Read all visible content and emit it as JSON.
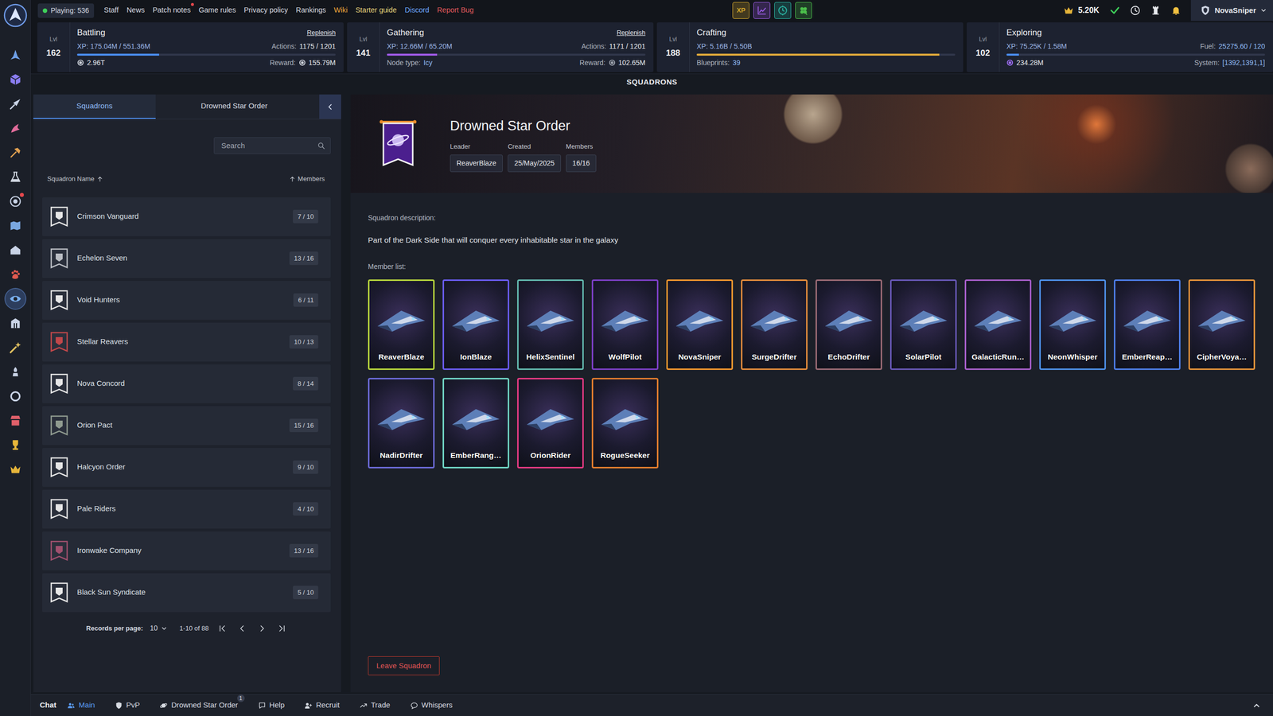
{
  "sidebar": {
    "items": [
      {
        "selected": false,
        "alert": false
      },
      {
        "selected": false,
        "alert": false
      },
      {
        "selected": false,
        "alert": false
      },
      {
        "selected": false,
        "alert": false
      },
      {
        "selected": false,
        "alert": false
      },
      {
        "selected": false,
        "alert": false
      },
      {
        "selected": false,
        "alert": true
      },
      {
        "selected": false,
        "alert": false
      },
      {
        "selected": false,
        "alert": false
      },
      {
        "selected": false,
        "alert": false
      },
      {
        "selected": true,
        "alert": false
      },
      {
        "selected": false,
        "alert": false
      },
      {
        "selected": false,
        "alert": false
      },
      {
        "selected": false,
        "alert": false
      },
      {
        "selected": false,
        "alert": false
      },
      {
        "selected": false,
        "alert": false
      },
      {
        "selected": false,
        "alert": false
      },
      {
        "selected": false,
        "alert": false
      }
    ]
  },
  "topbar": {
    "playing": "Playing: 536",
    "links": [
      {
        "label": "Staff",
        "color": "#d7dae0",
        "alert": false
      },
      {
        "label": "News",
        "color": "#d7dae0",
        "alert": false
      },
      {
        "label": "Patch notes",
        "color": "#d7dae0",
        "alert": true
      },
      {
        "label": "Game rules",
        "color": "#d7dae0",
        "alert": false
      },
      {
        "label": "Privacy policy",
        "color": "#d7dae0",
        "alert": false
      },
      {
        "label": "Rankings",
        "color": "#d7dae0",
        "alert": false
      },
      {
        "label": "Wiki",
        "color": "#f0a53a",
        "alert": false
      },
      {
        "label": "Starter guide",
        "color": "#e6d27a",
        "alert": false
      },
      {
        "label": "Discord",
        "color": "#6ea8ff",
        "alert": false
      },
      {
        "label": "Report Bug",
        "color": "#e2595b",
        "alert": false
      }
    ],
    "boosts": [
      {
        "label": "XP",
        "color": "#d4a72c"
      },
      {
        "color": "#9b5de5"
      },
      {
        "color": "#2bb3a3"
      },
      {
        "color": "#4cc04c"
      }
    ],
    "currency": "5.20K",
    "user": "NovaSniper"
  },
  "skills": [
    {
      "name": "Battling",
      "level_label": "Lvl",
      "level": "162",
      "xp": "XP: 175.04M / 551.36M",
      "fill": 0.317,
      "color": "#4a8cf0",
      "link": "Replenish",
      "mid_right": {
        "kind": "plain",
        "label": "Actions:",
        "value": "1175 / 1201"
      },
      "bottom_left": {
        "kind": "icon",
        "value": "2.96T",
        "color": "#c9ced6"
      },
      "bottom_right": {
        "kind": "icon",
        "label": "Reward:",
        "value": "155.79M",
        "color": "#c9ced6"
      }
    },
    {
      "name": "Gathering",
      "level_label": "Lvl",
      "level": "141",
      "xp": "XP: 12.66M / 65.20M",
      "fill": 0.194,
      "color": "#a05ae8",
      "link": "Replenish",
      "mid_right": {
        "kind": "plain",
        "label": "Actions:",
        "value": "1171 / 1201"
      },
      "bottom_left": {
        "kind": "text",
        "label": "Node type:",
        "value": "Icy"
      },
      "bottom_right": {
        "kind": "icon",
        "label": "Reward:",
        "value": "102.65M",
        "color": "#9aa0aa"
      }
    },
    {
      "name": "Crafting",
      "level_label": "Lvl",
      "level": "188",
      "xp": "XP: 5.16B / 5.50B",
      "fill": 0.938,
      "color": "#e0a93a",
      "bottom_left": {
        "kind": "text",
        "label": "Blueprints:",
        "value": "39"
      }
    },
    {
      "name": "Exploring",
      "level_label": "Lvl",
      "level": "102",
      "xp": "XP: 75.25K / 1.58M",
      "fill": 0.048,
      "color": "#4a8cf0",
      "mid_right": {
        "kind": "text",
        "label": "Fuel:",
        "value": "25275.60 / 120"
      },
      "bottom_left": {
        "kind": "icon",
        "value": "234.28M",
        "color": "#9b6cf0"
      },
      "bottom_right": {
        "kind": "text",
        "label": "System:",
        "value": "[1392,1391,1]"
      }
    }
  ],
  "page_title": "SQUADRONS",
  "squadrons_panel": {
    "tabs": [
      {
        "label": "Squadrons",
        "selected": true
      },
      {
        "label": "Drowned Star Order",
        "selected": false
      }
    ],
    "search": {
      "placeholder": "Search"
    },
    "columns": [
      {
        "label": "Squadron Name"
      },
      {
        "label": "Members"
      }
    ],
    "rows": [
      {
        "name": "Crimson Vanguard",
        "members": "7 / 10",
        "color": "#e6e6e6"
      },
      {
        "name": "Echelon Seven",
        "members": "13 / 16",
        "color": "#b9bcc2"
      },
      {
        "name": "Void Hunters",
        "members": "6 / 11",
        "color": "#e6e6e6"
      },
      {
        "name": "Stellar Reavers",
        "members": "10 / 13",
        "color": "#c0474a"
      },
      {
        "name": "Nova Concord",
        "members": "8 / 14",
        "color": "#e6e6e6"
      },
      {
        "name": "Orion Pact",
        "members": "15 / 16",
        "color": "#8f9a8f"
      },
      {
        "name": "Halcyon Order",
        "members": "9 / 10",
        "color": "#e6e6e6"
      },
      {
        "name": "Pale Riders",
        "members": "4 / 10",
        "color": "#e6e6e6"
      },
      {
        "name": "Ironwake Company",
        "members": "13 / 16",
        "color": "#a0506e"
      },
      {
        "name": "Black Sun Syndicate",
        "members": "5 / 10",
        "color": "#e6e6e6"
      }
    ],
    "pagination": {
      "label": "Records per page:",
      "per_page": "10",
      "range": "1-10 of 88"
    }
  },
  "squadron": {
    "name": "Drowned Star Order",
    "fields": [
      {
        "label": "Leader",
        "value": "ReaverBlaze"
      },
      {
        "label": "Created",
        "value": "25/May/2025"
      },
      {
        "label": "Members",
        "value": "16/16"
      }
    ],
    "description_label": "Squadron description:",
    "description": "Part of the Dark Side that will conquer every inhabitable star in the galaxy",
    "members_label": "Member list:",
    "members": [
      {
        "name": "ReaverBlaze",
        "color": "#b6d43c"
      },
      {
        "name": "IonBlaze",
        "color": "#6a5cf0"
      },
      {
        "name": "HelixSentinel",
        "color": "#62b8ad"
      },
      {
        "name": "WolfPilot",
        "color": "#7b3fc4"
      },
      {
        "name": "NovaSniper",
        "color": "#f0952e"
      },
      {
        "name": "SurgeDrifter",
        "color": "#e08a3c"
      },
      {
        "name": "EchoDrifter",
        "color": "#9a6a74"
      },
      {
        "name": "SolarPilot",
        "color": "#6757b5"
      },
      {
        "name": "GalacticRun…",
        "color": "#a65ec8"
      },
      {
        "name": "NeonWhisper",
        "color": "#4d8fe6"
      },
      {
        "name": "EmberReap…",
        "color": "#4d7de6"
      },
      {
        "name": "CipherVoya…",
        "color": "#e2913a"
      },
      {
        "name": "NadirDrifter",
        "color": "#6b6ad6"
      },
      {
        "name": "EmberRang…",
        "color": "#6fd4c4"
      },
      {
        "name": "OrionRider",
        "color": "#e23a80"
      },
      {
        "name": "RogueSeeker",
        "color": "#e07c2e"
      }
    ],
    "leave": "Leave Squadron"
  },
  "chat": {
    "title": "Chat",
    "tabs": [
      {
        "label": "Main",
        "selected": true
      },
      {
        "label": "PvP",
        "selected": false
      },
      {
        "label": "Drowned Star Order",
        "selected": false,
        "badge": "1"
      },
      {
        "label": "Help",
        "selected": false
      },
      {
        "label": "Recruit",
        "selected": false
      },
      {
        "label": "Trade",
        "selected": false
      },
      {
        "label": "Whispers",
        "selected": false
      }
    ]
  }
}
